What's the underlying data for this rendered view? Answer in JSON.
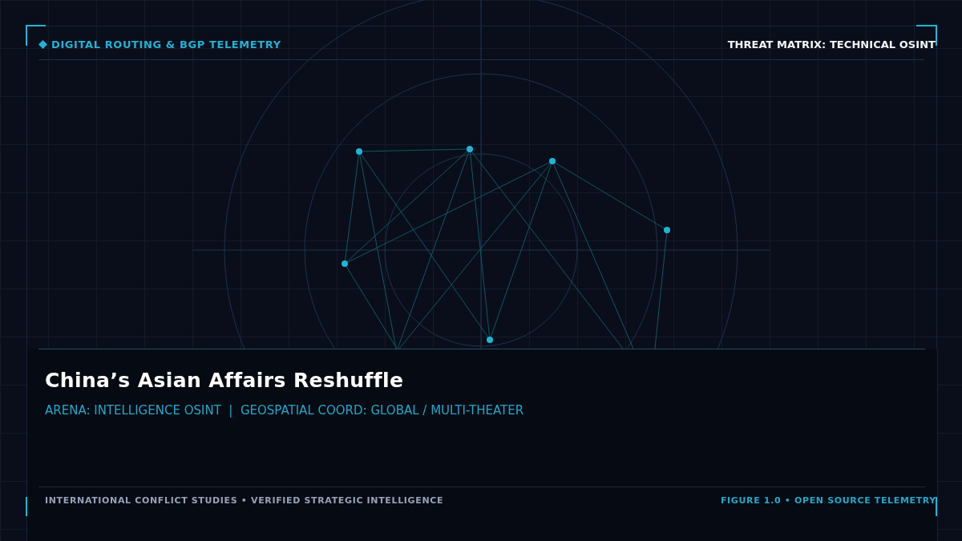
{
  "header": {
    "section_label": "DIGITAL ROUTING & BGP TELEMETRY",
    "classification": "THREAT MATRIX: TECHNICAL OSINT"
  },
  "panel": {
    "title": "China’s Asian Affairs Reshuffle",
    "subtitle": "ARENA: INTELLIGENCE OSINT  |  GEOSPATIAL COORD: GLOBAL / MULTI-THEATER"
  },
  "footer": {
    "source": "INTERNATIONAL CONFLICT STUDIES • VERIFIED STRATEGIC INTELLIGENCE",
    "figure": "FIGURE 1.0 • OPEN SOURCE TELEMETRY"
  }
}
